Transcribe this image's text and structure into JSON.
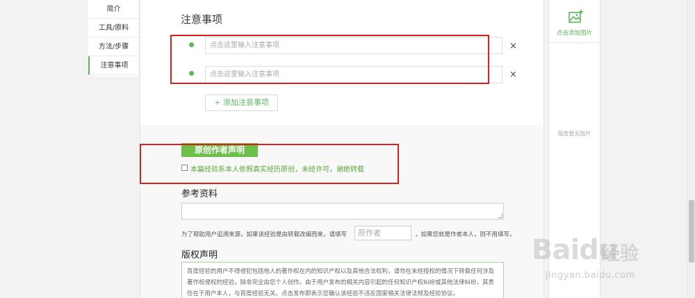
{
  "left_nav": {
    "items": [
      {
        "label": "简介",
        "active": false
      },
      {
        "label": "工具/原料",
        "active": false
      },
      {
        "label": "方法/步骤",
        "active": false
      },
      {
        "label": "注意事项",
        "active": true
      }
    ]
  },
  "notes_section": {
    "title": "注意事项",
    "inputs": [
      {
        "placeholder": "点击这里输入注意事项",
        "value": ""
      },
      {
        "placeholder": "点击这里输入注意事项",
        "value": ""
      }
    ],
    "remove_icon": "×",
    "add_button_label": "+ 添加注意事项"
  },
  "original_section": {
    "badge_label": "原创作者声明",
    "checkbox_checked": false,
    "checkbox_label": "本篇经验系本人依照真实经历原创，未经许可，谢绝转载"
  },
  "reference_section": {
    "title": "参考资料",
    "textarea_value": "",
    "help_text_before": "为了帮助用户追溯来源，如果该经验是由转载改编而来，请填写",
    "author_placeholder": "原作者",
    "help_text_after": "，如果您就是作者本人，则不用填写。"
  },
  "copyright_section": {
    "title": "版权声明",
    "text": "百度经验的用户不得侵犯包括他人的著作权在内的知识产权以及其他合法权利，请勿在未经授权的情况下转载任何涉及著作权侵权的经验，除非完全由您个人创作。由于用户发布的相关内容引起的任何知识产权纠纷或其他法律纠纷，其责任在于用户本人，与百度经验无关。点击发布即表示您确认该经验不违反国家相关法律法规及经验协议。"
  },
  "right_panel": {
    "add_image_label": "点击添加图片",
    "empty_label": "图库暂无图片"
  },
  "watermark": {
    "brand": "Bai",
    "brand2": "du",
    "brand_cn": "经验",
    "url": "jingyan.baidu.com"
  },
  "colors": {
    "accent_green": "#5bb85d",
    "badge_green": "#6cbf4a",
    "highlight_red": "#e01e1e"
  }
}
